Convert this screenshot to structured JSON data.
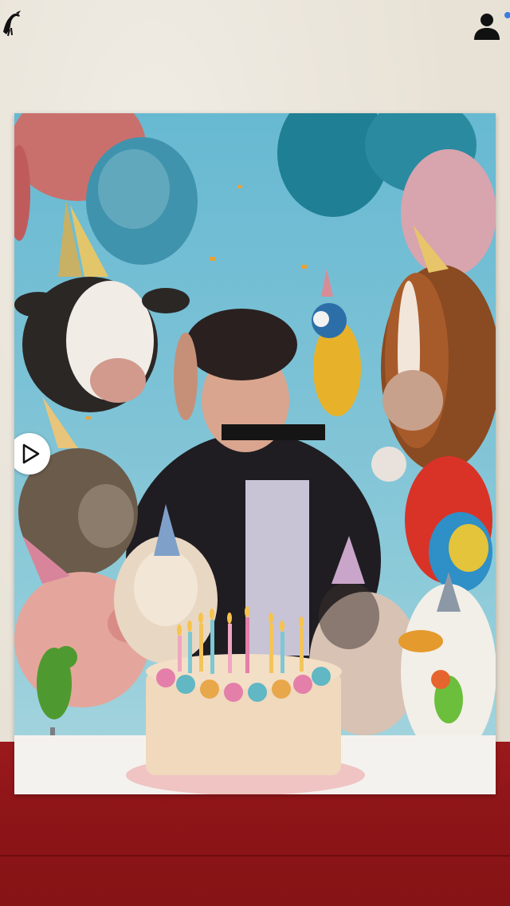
{
  "app": {
    "logo_icon": "bird-icon",
    "account_icon": "user-icon",
    "notification_indicator": true
  },
  "photo": {
    "scene_elements": [
      "balloons",
      "cow",
      "horse",
      "macaw",
      "donkey",
      "pig",
      "sheep",
      "cat",
      "duck",
      "lovebird",
      "cake",
      "candles",
      "party-hats"
    ]
  },
  "controls": {
    "play_icon": "play-icon"
  },
  "colors": {
    "background": "#e8e2d6",
    "floor": "#8e1518",
    "sky": "#7fc3d6",
    "accent_blue": "#3b7de0"
  }
}
